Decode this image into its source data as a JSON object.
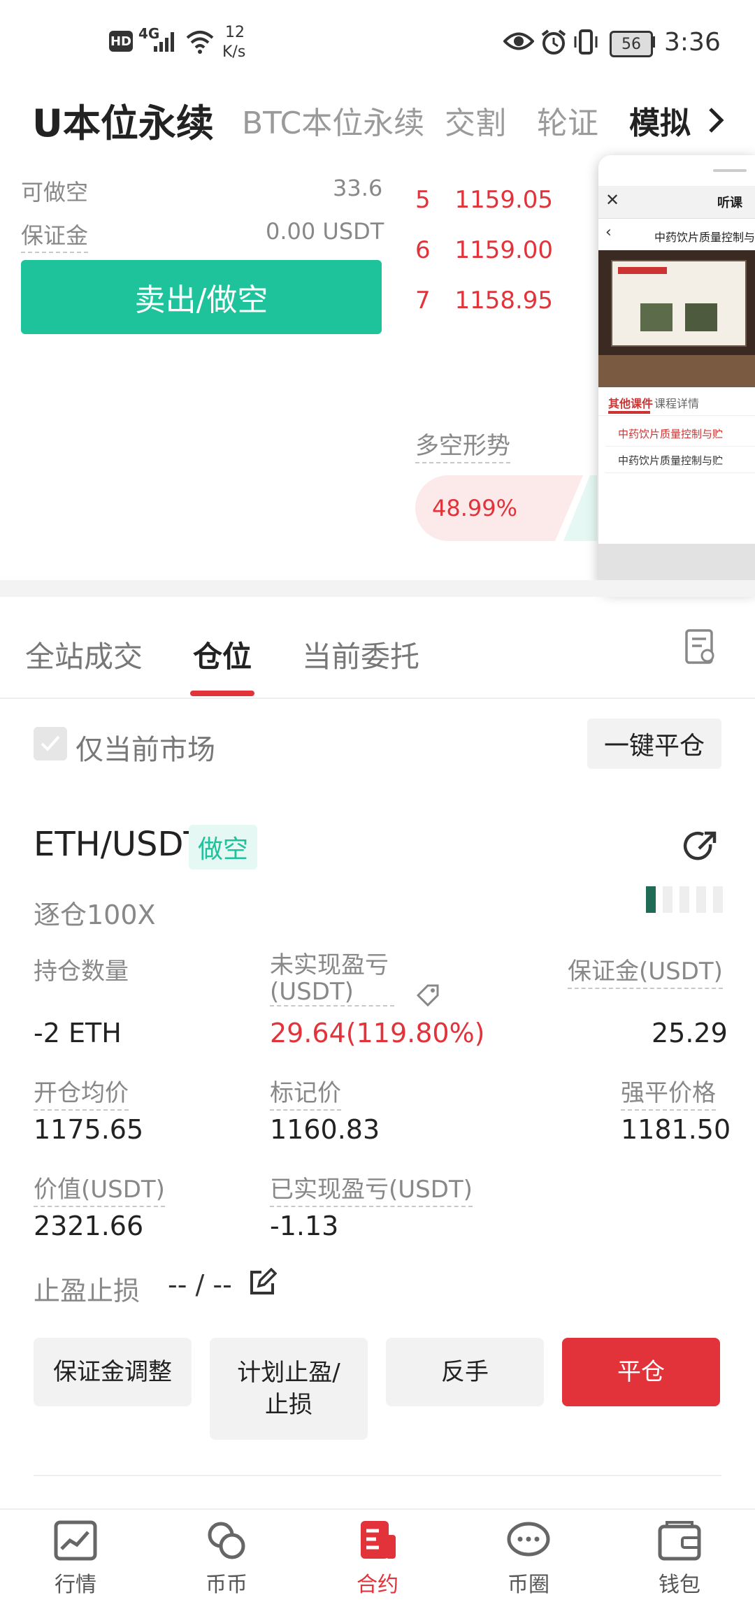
{
  "status_bar": {
    "network": "4G",
    "speed_value": "12",
    "speed_unit": "K/s",
    "battery": "56",
    "time": "3:36"
  },
  "top_tabs": [
    "U本位永续",
    "BTC本位永续",
    "交割",
    "轮证",
    "模拟"
  ],
  "trade": {
    "short_available_label": "可做空",
    "short_available_value": "33.6",
    "margin_label": "保证金",
    "margin_value": "0.00 USDT",
    "sell_button": "卖出/做空"
  },
  "orderbook": [
    {
      "idx": "5",
      "price": "1159.05"
    },
    {
      "idx": "6",
      "price": "1159.00"
    },
    {
      "idx": "7",
      "price": "1158.95"
    }
  ],
  "sentiment": {
    "label": "多空形势",
    "long_pct": "48.99%",
    "long_fraction": 0.4899
  },
  "floating_card": {
    "title": "听课",
    "subtitle": "中药饮片质量控制与",
    "tab_active": "其他课件",
    "tab_other": "课程详情",
    "items": [
      "中药饮片质量控制与贮",
      "中药饮片质量控制与贮"
    ]
  },
  "sub_tabs": [
    "全站成交",
    "仓位",
    "当前委托"
  ],
  "filter": {
    "only_current_market": "仅当前市场",
    "close_all": "一键平仓"
  },
  "position": {
    "symbol": "ETH/USDT",
    "side": "做空",
    "mode": "逐仓100X",
    "qty_label": "持仓数量",
    "qty_value": "-2 ETH",
    "upnl_label_1": "未实现盈亏",
    "upnl_label_2": "(USDT)",
    "upnl_value": "29.64(119.80%)",
    "margin_label": "保证金(USDT)",
    "margin_value": "25.29",
    "entry_label": "开仓均价",
    "entry_value": "1175.65",
    "mark_label": "标记价",
    "mark_value": "1160.83",
    "liq_label": "强平价格",
    "liq_value": "1181.50",
    "value_label": "价值(USDT)",
    "value_value": "2321.66",
    "realized_label": "已实现盈亏(USDT)",
    "realized_value": "-1.13",
    "tpsl_label": "止盈止损",
    "tpsl_value": "-- / --",
    "risk_level": 1
  },
  "actions": {
    "adjust_margin": "保证金调整",
    "plan_tpsl_1": "计划止盈/",
    "plan_tpsl_2": "止损",
    "reverse": "反手",
    "close": "平仓"
  },
  "bottom_nav": [
    "行情",
    "币币",
    "合约",
    "币圈",
    "钱包"
  ],
  "colors": {
    "accent_red": "#e2323a",
    "accent_green": "#1ec39b"
  }
}
